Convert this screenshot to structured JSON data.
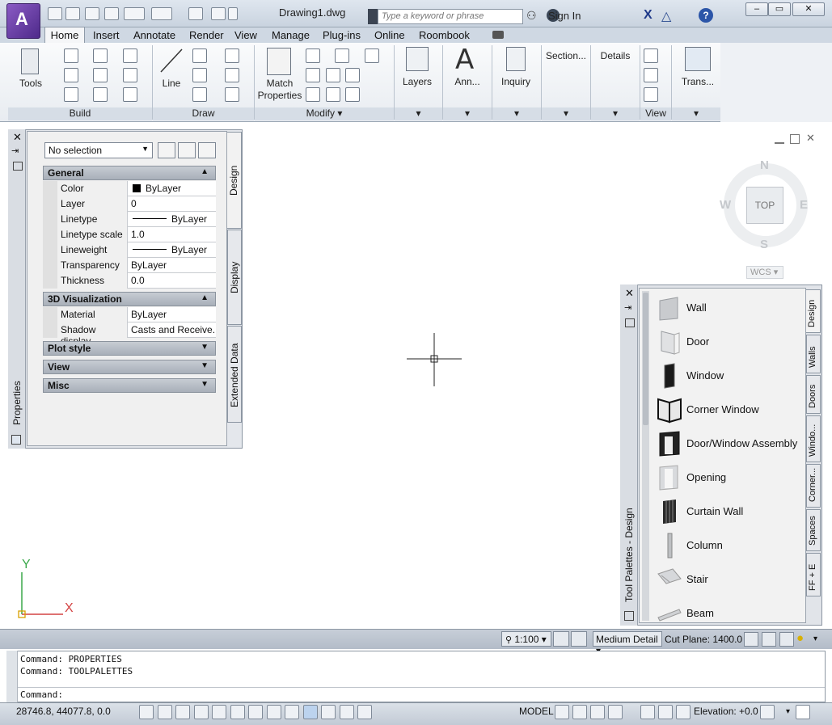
{
  "titlebar": {
    "document_title": "Drawing1.dwg",
    "search_placeholder": "Type a keyword or phrase",
    "sign_in": "Sign In"
  },
  "tabs": [
    "Home",
    "Insert",
    "Annotate",
    "Render",
    "View",
    "Manage",
    "Plug-ins",
    "Online",
    "Roombook"
  ],
  "ribbon": {
    "tools_label": "Tools",
    "line_label": "Line",
    "match_label1": "Match",
    "match_label2": "Properties",
    "layers_label": "Layers",
    "annotation_label": "Ann...",
    "inquiry_label": "Inquiry",
    "section_label": "Section...",
    "details_label": "Details",
    "trans_label": "Trans...",
    "panels": {
      "build": "Build",
      "draw": "Draw",
      "modify": "Modify",
      "view": "View"
    }
  },
  "properties": {
    "palette_title": "Properties",
    "selection": "No selection",
    "tabs": {
      "design": "Design",
      "display": "Display",
      "extended": "Extended Data"
    },
    "sections": {
      "general": "General",
      "viz": "3D Visualization",
      "plot": "Plot style",
      "view": "View",
      "misc": "Misc"
    },
    "general_rows": [
      {
        "key": "Color",
        "value": "ByLayer"
      },
      {
        "key": "Layer",
        "value": "0"
      },
      {
        "key": "Linetype",
        "value": "ByLayer"
      },
      {
        "key": "Linetype scale",
        "value": "1.0"
      },
      {
        "key": "Lineweight",
        "value": "ByLayer"
      },
      {
        "key": "Transparency",
        "value": "ByLayer"
      },
      {
        "key": "Thickness",
        "value": "0.0"
      }
    ],
    "viz_rows": [
      {
        "key": "Material",
        "value": "ByLayer"
      },
      {
        "key": "Shadow display",
        "value": "Casts and Receive..."
      }
    ]
  },
  "viewcube": {
    "north": "N",
    "south": "S",
    "east": "E",
    "west": "W",
    "top": "TOP",
    "wcs": "WCS"
  },
  "tool_palette": {
    "title": "Tool Palettes - Design",
    "tabs": [
      "Design",
      "Walls",
      "Doors",
      "Windo...",
      "Corner...",
      "Spaces",
      "FF + E"
    ],
    "tools": [
      "Wall",
      "Door",
      "Window",
      "Corner Window",
      "Door/Window Assembly",
      "Opening",
      "Curtain Wall",
      "Column",
      "Stair",
      "Beam"
    ]
  },
  "layoutbar": {
    "scale": "1:100",
    "detail": "Medium Detail",
    "cut_plane": "Cut Plane:",
    "cut_value": "1400.0"
  },
  "command": {
    "lines": [
      "Command: PROPERTIES",
      "Command: TOOLPALETTES"
    ],
    "prompt": "Command:"
  },
  "status": {
    "coords": "28746.8, 44077.8, 0.0",
    "model": "MODEL",
    "elevation": "Elevation: +0.0"
  },
  "ucs": {
    "x": "X",
    "y": "Y"
  },
  "colors": {
    "accent": "#6b3fa8",
    "ucs_x": "#d44444",
    "ucs_y": "#3aa84a"
  }
}
